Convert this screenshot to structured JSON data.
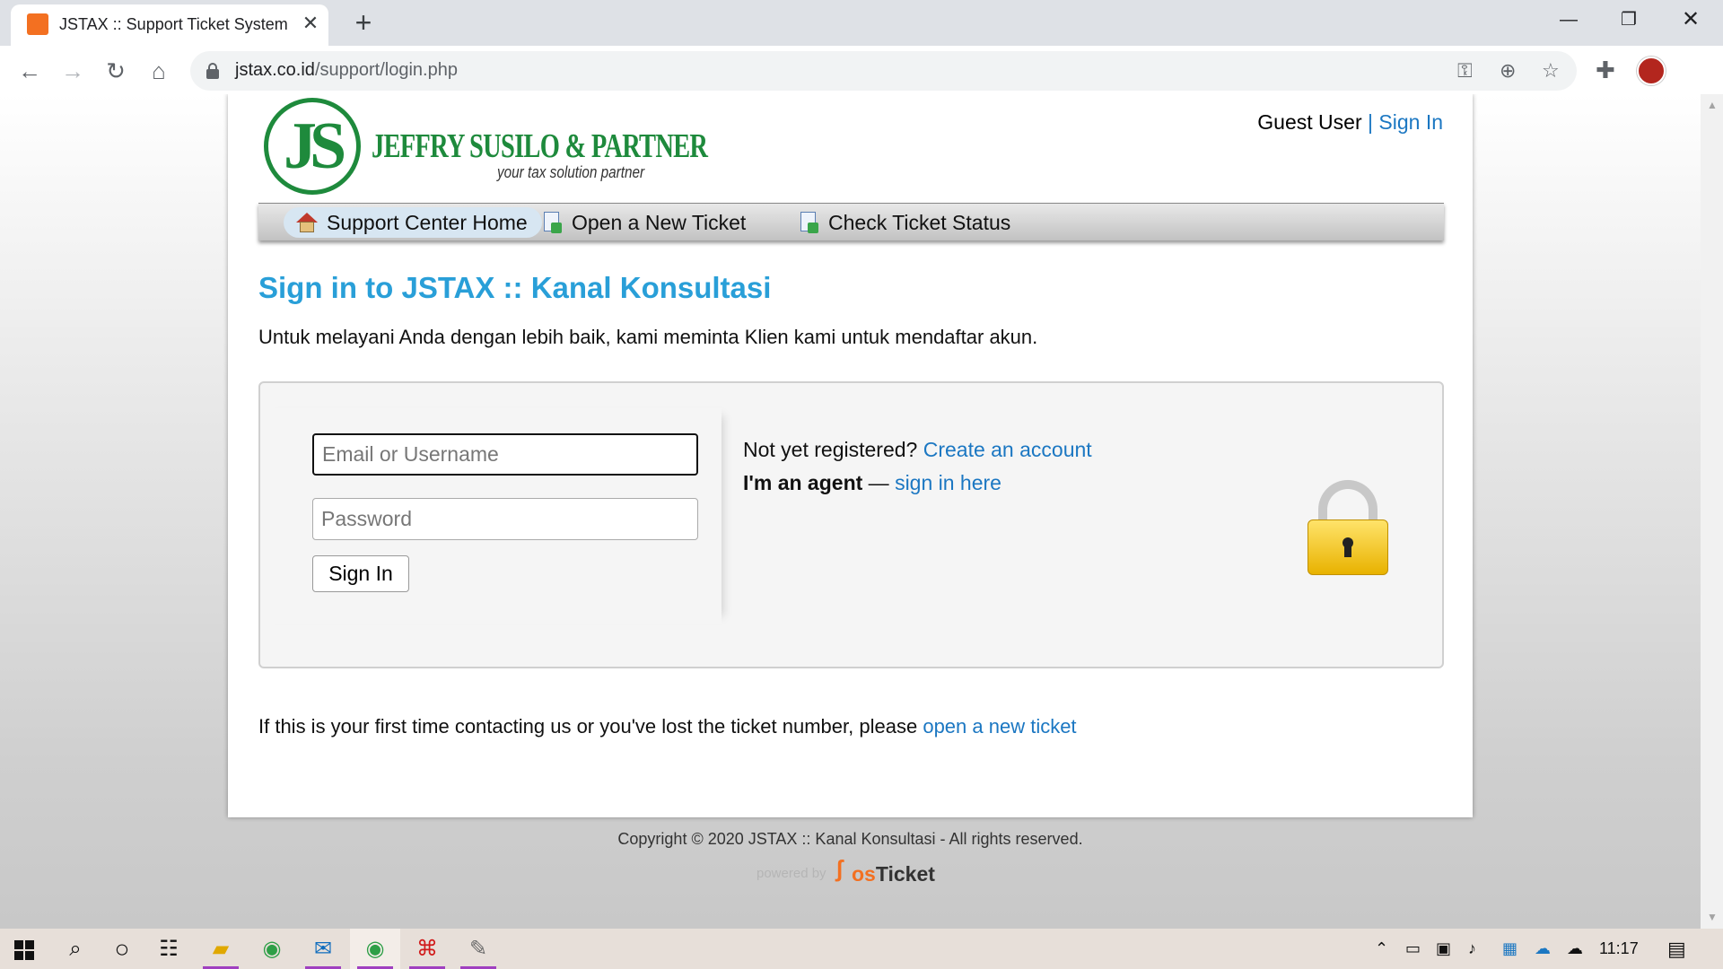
{
  "browser": {
    "tab_title": "JSTAX :: Support Ticket System",
    "url_domain": "jstax.co.id",
    "url_path": "/support/login.php"
  },
  "header": {
    "logo_letters": "JS",
    "logo_name": "JEFFRY SUSILO & PARTNER",
    "logo_tagline": "your tax solution partner",
    "guest_label": "Guest User",
    "separator": "|",
    "sign_in_link": "Sign In"
  },
  "nav": {
    "items": [
      {
        "label": "Support Center Home",
        "icon": "home-icon",
        "active": true
      },
      {
        "label": "Open a New Ticket",
        "icon": "new-ticket-icon",
        "active": false
      },
      {
        "label": "Check Ticket Status",
        "icon": "ticket-status-icon",
        "active": false
      }
    ]
  },
  "main": {
    "title": "Sign in to JSTAX :: Kanal Konsultasi",
    "intro": "Untuk melayani Anda dengan lebih baik, kami meminta Klien kami untuk mendaftar akun.",
    "login": {
      "email_placeholder": "Email or Username",
      "password_placeholder": "Password",
      "sign_in_button": "Sign In",
      "not_registered": "Not yet registered?",
      "create_account": "Create an account",
      "agent_label": "I'm an agent",
      "agent_dash": "—",
      "agent_link": "sign in here"
    },
    "first_time_text": "If this is your first time contacting us or you've lost the ticket number, please",
    "first_time_link": "open a new ticket"
  },
  "footer": {
    "copyright": "Copyright © 2020 JSTAX :: Kanal Konsultasi - All rights reserved.",
    "powered_by": "powered by",
    "brand_os": "os",
    "brand_ticket": "Ticket"
  },
  "taskbar": {
    "clock": "11:17"
  },
  "colors": {
    "link": "#1b77c2",
    "title": "#299fd8",
    "logo_green": "#1e8a3c",
    "osticket_orange": "#f37021"
  }
}
